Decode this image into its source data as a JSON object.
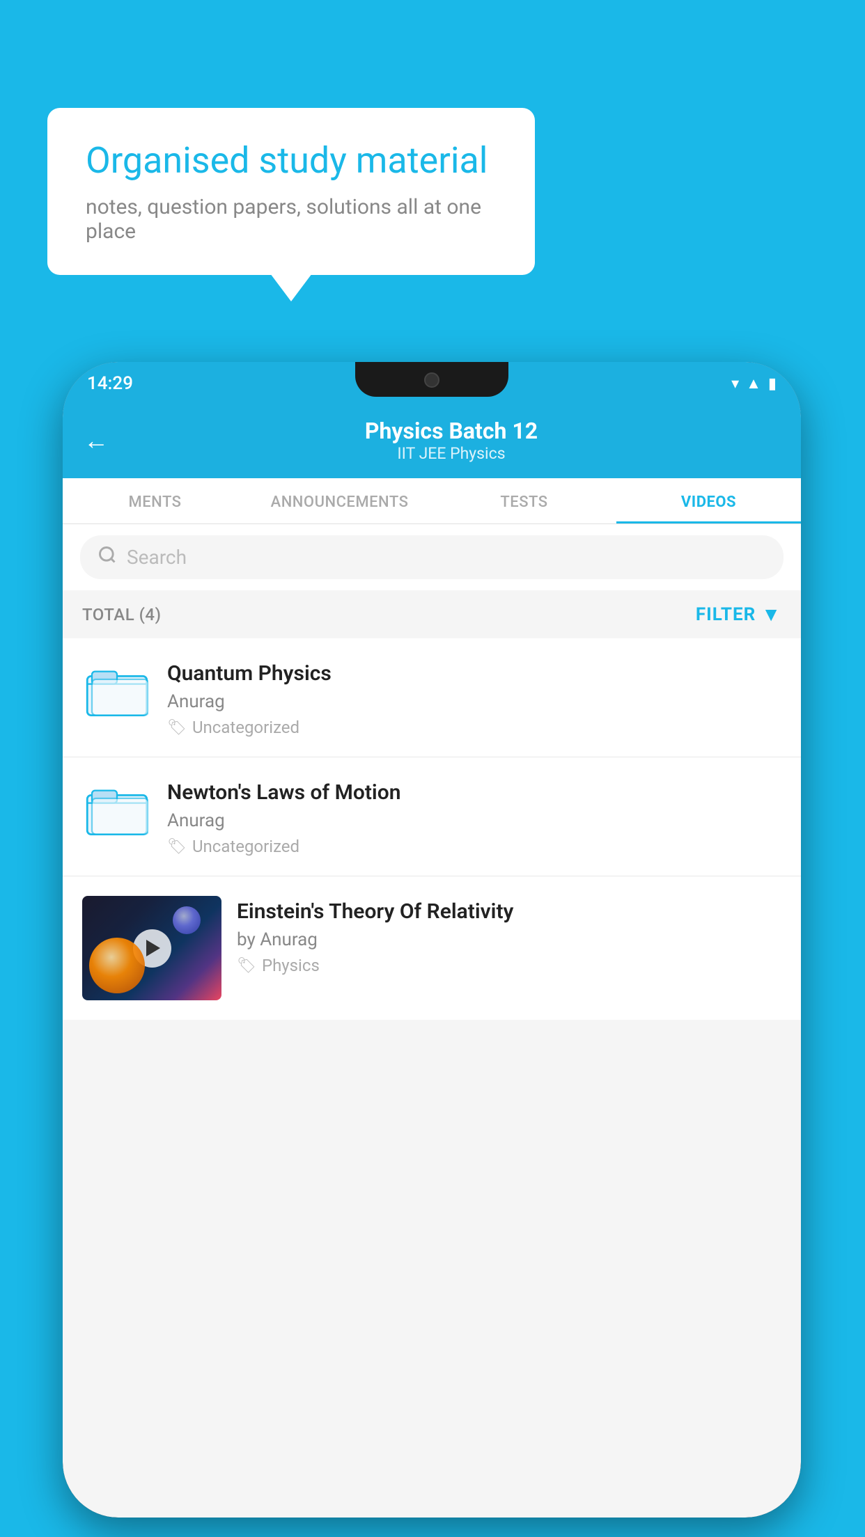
{
  "background_color": "#1ab8e8",
  "speech_bubble": {
    "heading": "Organised study material",
    "subtext": "notes, question papers, solutions all at one place"
  },
  "phone": {
    "status_bar": {
      "time": "14:29",
      "icons": [
        "wifi",
        "signal",
        "battery"
      ]
    },
    "header": {
      "title": "Physics Batch 12",
      "subtitle": "IIT JEE   Physics",
      "back_label": "←"
    },
    "tabs": [
      {
        "label": "MENTS",
        "active": false
      },
      {
        "label": "ANNOUNCEMENTS",
        "active": false
      },
      {
        "label": "TESTS",
        "active": false
      },
      {
        "label": "VIDEOS",
        "active": true
      }
    ],
    "search": {
      "placeholder": "Search"
    },
    "filter_bar": {
      "total_label": "TOTAL (4)",
      "filter_label": "FILTER"
    },
    "videos": [
      {
        "title": "Quantum Physics",
        "author": "Anurag",
        "tag": "Uncategorized",
        "has_thumbnail": false
      },
      {
        "title": "Newton's Laws of Motion",
        "author": "Anurag",
        "tag": "Uncategorized",
        "has_thumbnail": false
      },
      {
        "title": "Einstein's Theory Of Relativity",
        "author": "by Anurag",
        "tag": "Physics",
        "has_thumbnail": true
      }
    ]
  }
}
